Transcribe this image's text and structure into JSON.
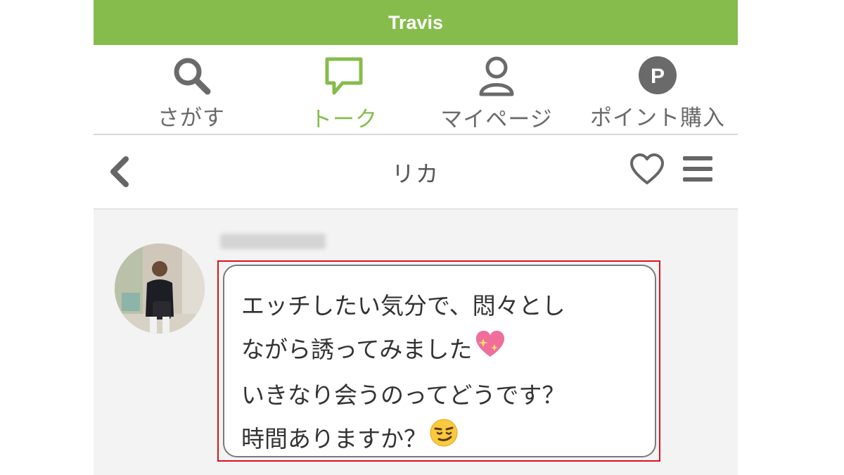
{
  "app": {
    "title": "Travis"
  },
  "nav": {
    "items": [
      {
        "label": "さがす",
        "icon": "search-icon",
        "active": false
      },
      {
        "label": "トーク",
        "icon": "chat-bubble-icon",
        "active": true
      },
      {
        "label": "マイページ",
        "icon": "person-icon",
        "active": false
      },
      {
        "label": "ポイント購入",
        "icon": "points-p-icon",
        "active": false
      }
    ]
  },
  "chat": {
    "title": "リカ",
    "icons": {
      "back": "chevron-left-icon",
      "favorite": "heart-outline-icon",
      "menu": "hamburger-menu-icon"
    },
    "message": {
      "lines": [
        "エッチしたい気分で、悶々とし",
        "ながら誘ってみました",
        "いきなり会うのってどうです？",
        "時間ありますか？"
      ],
      "emojis": [
        "sparkling-heart-emoji",
        "smirking-face-emoji"
      ]
    }
  },
  "colors": {
    "accent": "#86bc4c",
    "highlight": "#e0101d",
    "icon_gray": "#6a6a6a"
  }
}
